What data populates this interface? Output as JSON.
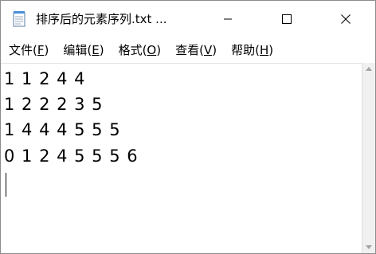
{
  "window": {
    "title": "排序后的元素序列.txt ...",
    "app_icon": "notepad-icon",
    "controls": {
      "minimize": "minimize-icon",
      "maximize": "maximize-icon",
      "close": "close-icon"
    }
  },
  "menu": {
    "items": [
      {
        "label": "文件(",
        "key": "F",
        "suffix": ")"
      },
      {
        "label": "编辑(",
        "key": "E",
        "suffix": ")"
      },
      {
        "label": "格式(",
        "key": "O",
        "suffix": ")"
      },
      {
        "label": "查看(",
        "key": "V",
        "suffix": ")"
      },
      {
        "label": "帮助(",
        "key": "H",
        "suffix": ")"
      }
    ]
  },
  "editor": {
    "lines": [
      "1 1 2 4 4",
      "1 2 2 2 3 5",
      "1 4 4 4 5 5 5",
      "0 1 2 4 5 5 5 6"
    ]
  },
  "colors": {
    "background": "#ffffff",
    "border": "#8c8c8c",
    "scrollbar": "#f0f0f0"
  }
}
